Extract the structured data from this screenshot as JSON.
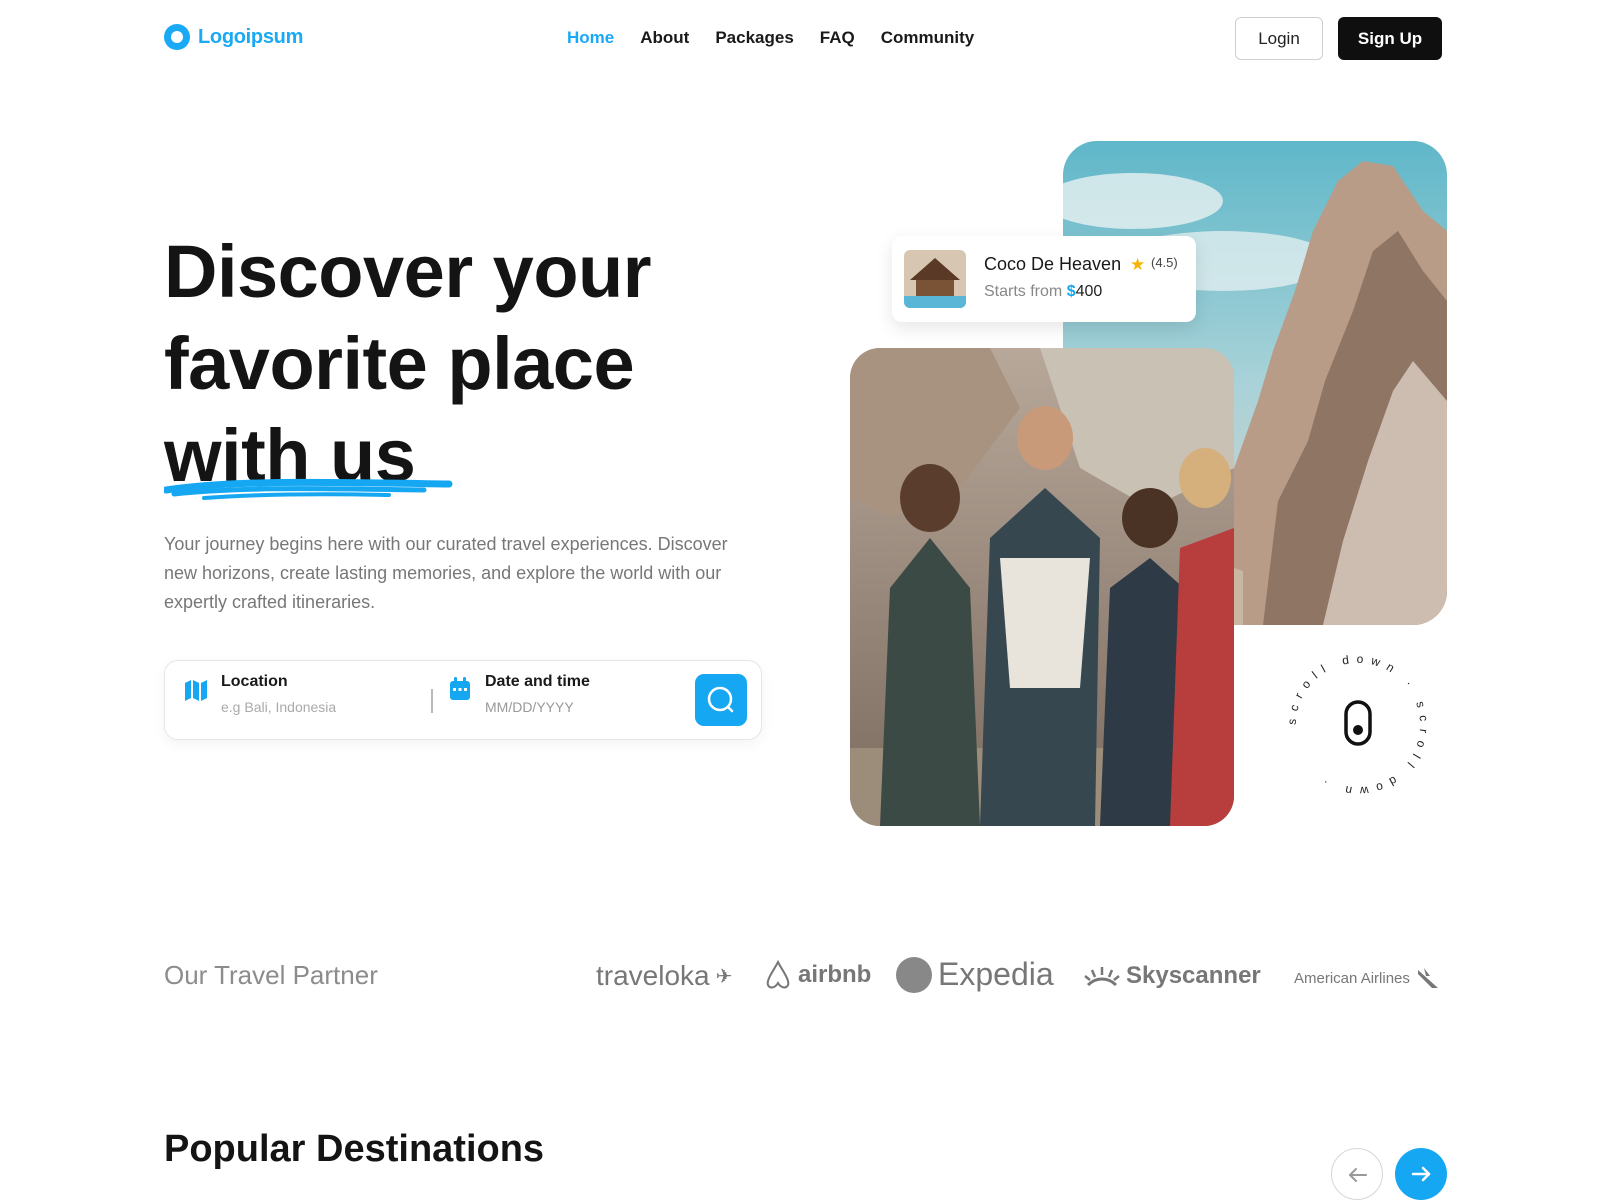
{
  "brand": {
    "name": "Logoipsum",
    "accent": "#1aa9f5"
  },
  "nav": {
    "items": [
      {
        "label": "Home",
        "active": true
      },
      {
        "label": "About"
      },
      {
        "label": "Packages"
      },
      {
        "label": "FAQ"
      },
      {
        "label": "Community"
      }
    ],
    "login_label": "Login",
    "signup_label": "Sign Up"
  },
  "hero": {
    "headline_line1": "Discover your",
    "headline_line2": "favorite place",
    "headline_line3": "with us",
    "description": "Your journey begins here with our curated travel experiences. Discover new horizons, create lasting memories, and explore the world with our expertly crafted itineraries."
  },
  "search": {
    "location_label": "Location",
    "location_placeholder": "e.g Bali, Indonesia",
    "date_label": "Date and time",
    "date_placeholder": "MM/DD/YYYY"
  },
  "hotel_card": {
    "name": "Coco De Heaven",
    "rating": "(4.5)",
    "price_prefix": "Starts from ",
    "currency": "$",
    "price": "400"
  },
  "scroll_hint": {
    "text": "scroll down · scroll down · ",
    "icon": "mouse-icon"
  },
  "partners": {
    "title": "Our Travel Partner",
    "logos": [
      "traveloka",
      "airbnb",
      "Expedia",
      "Skyscanner",
      "American Airlines"
    ]
  },
  "destinations": {
    "title": "Popular Destinations"
  }
}
